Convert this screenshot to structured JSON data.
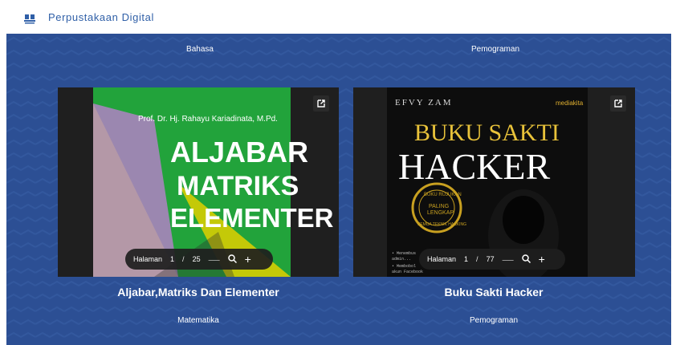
{
  "header": {
    "brand": "Perpustakaan Digital"
  },
  "top_categories": [
    "Bahasa",
    "Pemograman"
  ],
  "books": [
    {
      "cover_author": "Prof. Dr. Hj. Rahayu Kariadinata, M.Pd.",
      "cover_title_lines": [
        "ALJABAR",
        "MATRIKS",
        "ELEMENTER"
      ],
      "pager": {
        "label": "Halaman",
        "page": "1",
        "sep": "/",
        "total": "25"
      },
      "title": "Aljabar,Matriks Dan Elementer",
      "category": "Matematika"
    },
    {
      "cover_author": "EFVY ZAM",
      "cover_publisher": "mediakita",
      "cover_title_lines": [
        "BUKU SAKTI",
        "HACKER"
      ],
      "cover_badge_lines": [
        "BUKU RUJUKAN",
        "PALING",
        "LENGKAP",
        "SEMUA TEKNIK HACKING"
      ],
      "cover_bullets": [
        "• Menembus",
        "  admin...",
        "• Membobol",
        "  akun Facebook"
      ],
      "pager": {
        "label": "Halaman",
        "page": "1",
        "sep": "/",
        "total": "77"
      },
      "title": "Buku Sakti Hacker",
      "category": "Pemograman"
    }
  ],
  "colors": {
    "brand": "#2f5fa7",
    "panel": "#2c4f94",
    "green_cover": "#22a33b",
    "dark_card": "#1f1f1f"
  }
}
